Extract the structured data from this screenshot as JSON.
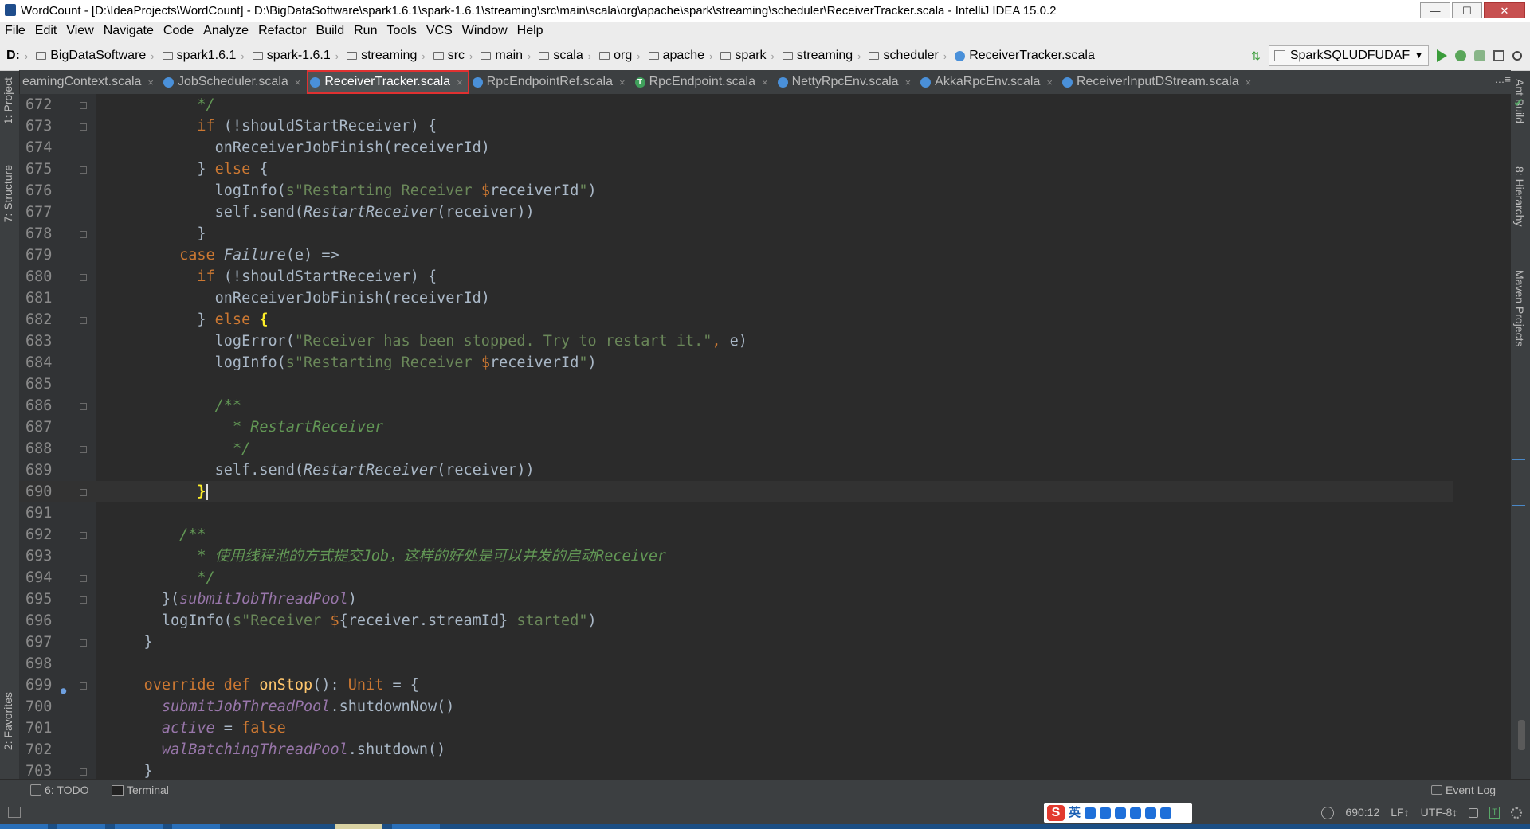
{
  "window": {
    "title": "WordCount - [D:\\IdeaProjects\\WordCount] - D:\\BigDataSoftware\\spark1.6.1\\spark-1.6.1\\streaming\\src\\main\\scala\\org\\apache\\spark\\streaming\\scheduler\\ReceiverTracker.scala - IntelliJ IDEA 15.0.2",
    "minimize": "—",
    "maximize": "☐",
    "close": "✕"
  },
  "menu": [
    "File",
    "Edit",
    "View",
    "Navigate",
    "Code",
    "Analyze",
    "Refactor",
    "Build",
    "Run",
    "Tools",
    "VCS",
    "Window",
    "Help"
  ],
  "breadcrumbs": [
    "D:",
    "BigDataSoftware",
    "spark1.6.1",
    "spark-1.6.1",
    "streaming",
    "src",
    "main",
    "scala",
    "org",
    "apache",
    "spark",
    "streaming",
    "scheduler",
    "ReceiverTracker.scala"
  ],
  "run_config": "SparkSQLUDFUDAF",
  "tabs": [
    {
      "label": "eamingContext.scala",
      "icon": "class-icon",
      "active": false
    },
    {
      "label": "JobScheduler.scala",
      "icon": "class-icon",
      "active": false
    },
    {
      "label": "ReceiverTracker.scala",
      "icon": "class-icon",
      "active": true
    },
    {
      "label": "RpcEndpointRef.scala",
      "icon": "class-icon",
      "active": false
    },
    {
      "label": "RpcEndpoint.scala",
      "icon": "trait-icon",
      "active": false
    },
    {
      "label": "NettyRpcEnv.scala",
      "icon": "class-icon",
      "active": false
    },
    {
      "label": "AkkaRpcEnv.scala",
      "icon": "class-icon",
      "active": false
    },
    {
      "label": "ReceiverInputDStream.scala",
      "icon": "class-icon",
      "active": false
    }
  ],
  "tab_close": "×",
  "trait_letter": "T",
  "tabs_menu": "…≡",
  "side_tools": {
    "project": "1: Project",
    "structure": "7: Structure",
    "favorites": "2: Favorites",
    "ant": "Ant Build",
    "hierarchy": "8: Hierarchy",
    "maven": "Maven Projects"
  },
  "bottom_tools": {
    "todo": "6: TODO",
    "terminal": "Terminal",
    "event_log": "Event Log"
  },
  "status": {
    "position": "690:12",
    "line_sep": "LF↕",
    "encoding": "UTF-8↕",
    "ime_label": "英",
    "ime_logo": "S"
  },
  "code": [
    {
      "n": "672",
      "html": "          <span class=\"c\">*/</span>"
    },
    {
      "n": "673",
      "html": "          <span class=\"k\">if</span> (!shouldStartReceiver) {"
    },
    {
      "n": "674",
      "html": "            onReceiverJobFinish(receiverId)"
    },
    {
      "n": "675",
      "html": "          } <span class=\"k\">else</span> {"
    },
    {
      "n": "676",
      "html": "            logInfo(<span class=\"s\">s\"Restarting Receiver </span><span class=\"k\">$</span>receiverId<span class=\"s\">\"</span>)"
    },
    {
      "n": "677",
      "html": "            self.send(<span class=\"t\">RestartReceiver</span>(receiver))"
    },
    {
      "n": "678",
      "html": "          }"
    },
    {
      "n": "679",
      "html": "        <span class=\"k\">case</span> <span class=\"t\">Failure</span>(e) =&gt;"
    },
    {
      "n": "680",
      "html": "          <span class=\"k\">if</span> (!shouldStartReceiver) {"
    },
    {
      "n": "681",
      "html": "            onReceiverJobFinish(receiverId)"
    },
    {
      "n": "682",
      "html": "          } <span class=\"k\">else</span> <span class=\"bt\">{</span>"
    },
    {
      "n": "683",
      "html": "            logError(<span class=\"s\">\"Receiver has been stopped. Try to restart it.\"</span><span class=\"k\">,</span> e)"
    },
    {
      "n": "684",
      "html": "            logInfo(<span class=\"s\">s\"Restarting Receiver </span><span class=\"k\">$</span>receiverId<span class=\"s\">\"</span>)"
    },
    {
      "n": "685",
      "html": ""
    },
    {
      "n": "686",
      "html": "            <span class=\"c\">/**</span>"
    },
    {
      "n": "687",
      "html": "              <span class=\"c\">* RestartReceiver</span>"
    },
    {
      "n": "688",
      "html": "              <span class=\"c\">*/</span>"
    },
    {
      "n": "689",
      "html": "            self.send(<span class=\"t\">RestartReceiver</span>(receiver))"
    },
    {
      "n": "690",
      "html": "          <span class=\"bt\">}</span><span class=\"caret\"></span>"
    },
    {
      "n": "691",
      "html": ""
    },
    {
      "n": "692",
      "html": "        <span class=\"c\">/**</span>"
    },
    {
      "n": "693",
      "html": "          <span class=\"c\">* 使用线程池的方式提交Job，这样的好处是可以并发的启动Receiver</span>"
    },
    {
      "n": "694",
      "html": "          <span class=\"c\">*/</span>"
    },
    {
      "n": "695",
      "html": "      }(<span class=\"f\">submitJobThreadPool</span>)"
    },
    {
      "n": "696",
      "html": "      logInfo(<span class=\"s\">s\"Receiver </span><span class=\"k\">$</span>{receiver.streamId}<span class=\"s\"> started\"</span>)"
    },
    {
      "n": "697",
      "html": "    }"
    },
    {
      "n": "698",
      "html": ""
    },
    {
      "n": "699",
      "html": "    <span class=\"k\">override def</span> <span class=\"d\">onStop</span>(): <span class=\"k\">Unit</span> = {"
    },
    {
      "n": "700",
      "html": "      <span class=\"f\">submitJobThreadPool</span>.shutdownNow()"
    },
    {
      "n": "701",
      "html": "      <span class=\"f\">active</span> = <span class=\"k\">false</span>"
    },
    {
      "n": "702",
      "html": "      <span class=\"f\">walBatchingThreadPool</span>.shutdown()"
    },
    {
      "n": "703",
      "html": "    }"
    }
  ],
  "current_line": "690",
  "colors": {
    "keyword": "#cc7832",
    "string": "#6a8759",
    "field": "#9876aa",
    "comment": "#629755",
    "active_tab_outline": "#e03131"
  }
}
